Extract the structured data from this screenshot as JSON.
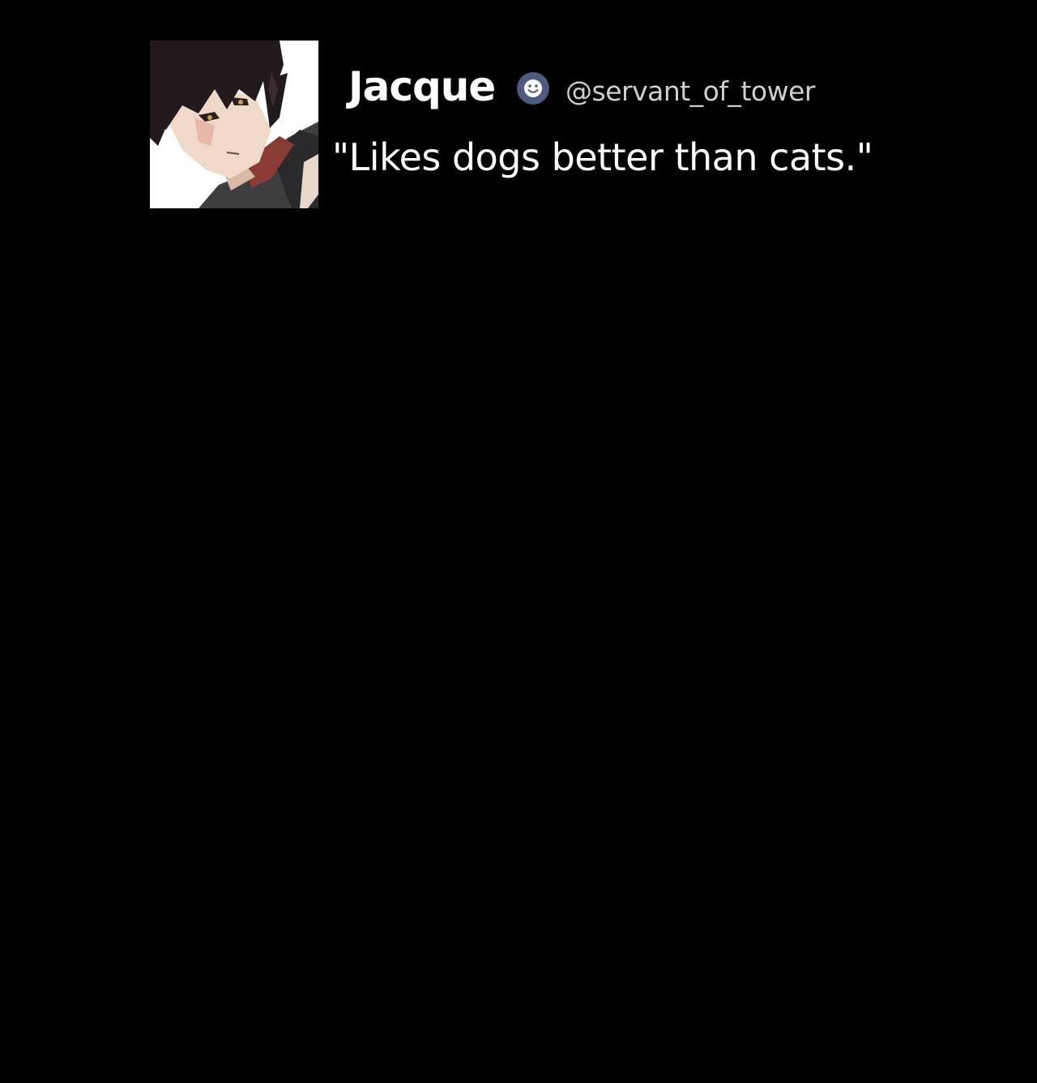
{
  "post": {
    "display_name": "Jacque",
    "handle": "@servant_of_tower",
    "text": "\"Likes dogs better than cats.\"",
    "badge_icon": "smiley-badge-icon",
    "avatar_icon": "anime-character-avatar"
  },
  "colors": {
    "background": "#000000",
    "name": "#ffffff",
    "handle": "#cfcfcf",
    "text": "#ffffff",
    "badge": "#4d5b80"
  }
}
